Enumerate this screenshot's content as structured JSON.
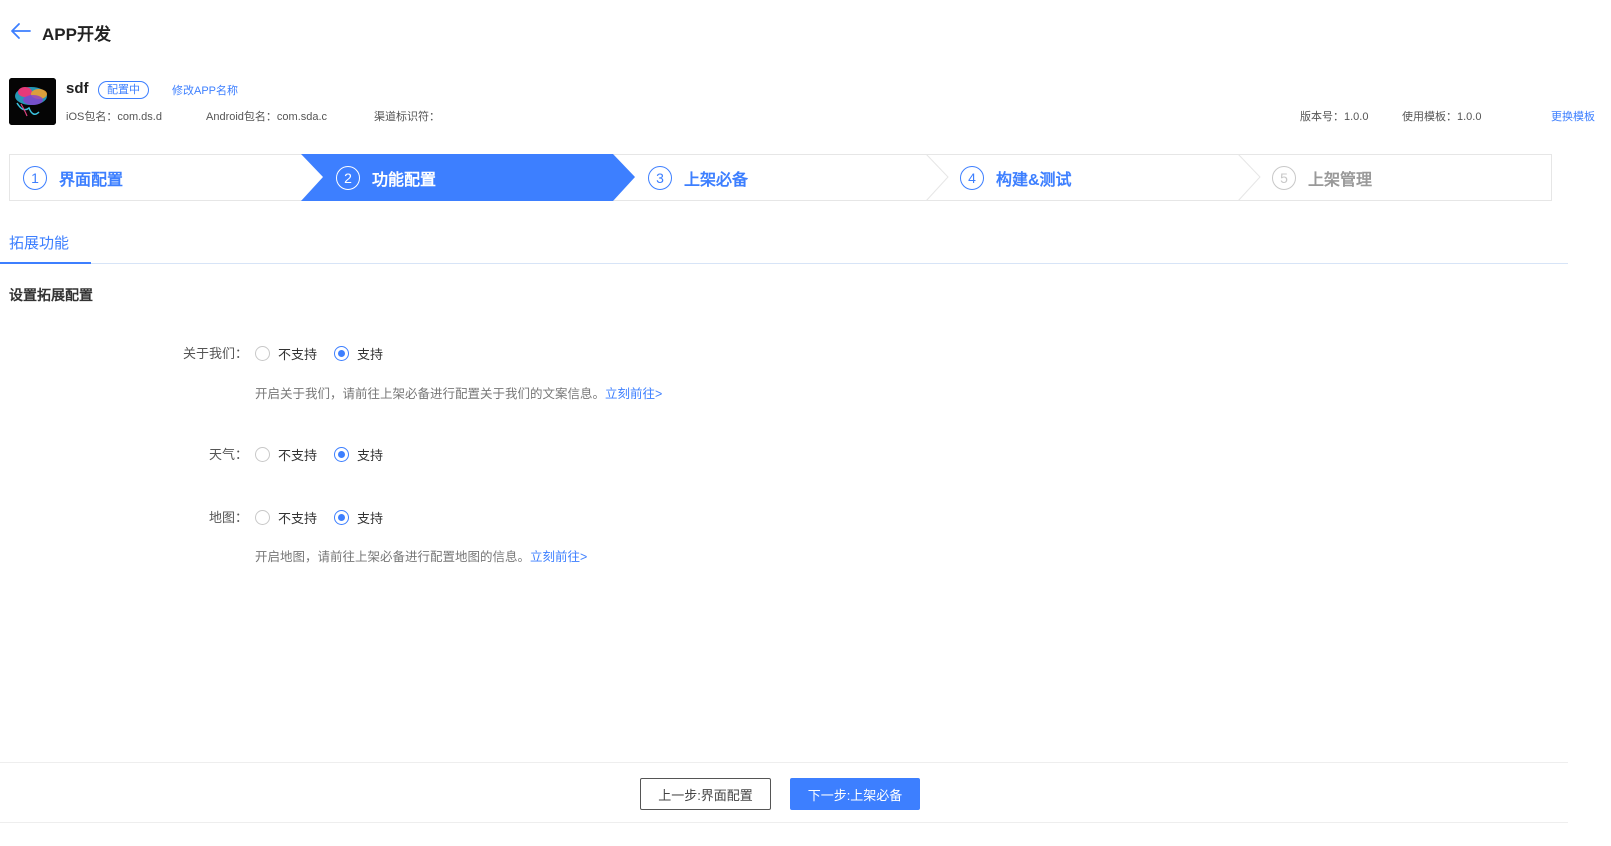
{
  "header": {
    "title": "APP开发"
  },
  "app": {
    "name": "sdf",
    "status": "配置中",
    "rename_link": "修改APP名称",
    "ios_package": "iOS包名：com.ds.d",
    "android_package": "Android包名：com.sda.c",
    "channel": "渠道标识符：",
    "version": "版本号：1.0.0",
    "template_version": "使用模板：1.0.0",
    "change_template": "更换模板"
  },
  "steps": [
    {
      "num": "1",
      "label": "界面配置",
      "state": "done"
    },
    {
      "num": "2",
      "label": "功能配置",
      "state": "active"
    },
    {
      "num": "3",
      "label": "上架必备",
      "state": "pending"
    },
    {
      "num": "4",
      "label": "构建&测试",
      "state": "pending"
    },
    {
      "num": "5",
      "label": "上架管理",
      "state": "disabled"
    }
  ],
  "tabs": {
    "active": "拓展功能"
  },
  "section": {
    "title": "设置拓展配置"
  },
  "options": {
    "no": "不支持",
    "yes": "支持"
  },
  "features": [
    {
      "label": "关于我们：",
      "selected": "支持",
      "hint": "开启关于我们，请前往上架必备进行配置关于我们的文案信息。",
      "hint_link": "立刻前往>"
    },
    {
      "label": "天气：",
      "selected": "支持"
    },
    {
      "label": "地图：",
      "selected": "支持",
      "hint": "开启地图，请前往上架必备进行配置地图的信息。",
      "hint_link": "立刻前往>"
    }
  ],
  "footer": {
    "prev_label": "上一步:界面配置",
    "next_label": "下一步:上架必备"
  },
  "colors": {
    "accent": "#3d7fff",
    "border": "#e6e6e6"
  }
}
